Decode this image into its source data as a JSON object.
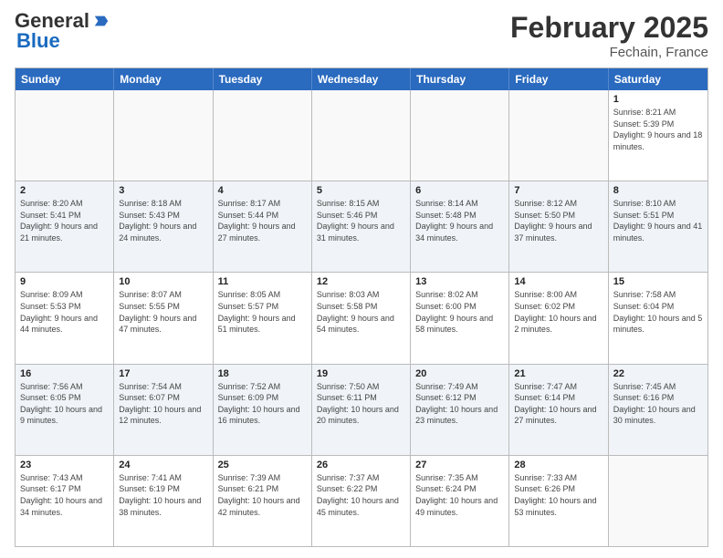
{
  "header": {
    "logo_general": "General",
    "logo_blue": "Blue",
    "month_title": "February 2025",
    "location": "Fechain, France"
  },
  "days_of_week": [
    "Sunday",
    "Monday",
    "Tuesday",
    "Wednesday",
    "Thursday",
    "Friday",
    "Saturday"
  ],
  "rows": [
    [
      {
        "day": "",
        "detail": "",
        "empty": true
      },
      {
        "day": "",
        "detail": "",
        "empty": true
      },
      {
        "day": "",
        "detail": "",
        "empty": true
      },
      {
        "day": "",
        "detail": "",
        "empty": true
      },
      {
        "day": "",
        "detail": "",
        "empty": true
      },
      {
        "day": "",
        "detail": "",
        "empty": true
      },
      {
        "day": "1",
        "detail": "Sunrise: 8:21 AM\nSunset: 5:39 PM\nDaylight: 9 hours and 18 minutes.",
        "empty": false
      }
    ],
    [
      {
        "day": "2",
        "detail": "Sunrise: 8:20 AM\nSunset: 5:41 PM\nDaylight: 9 hours and 21 minutes.",
        "empty": false
      },
      {
        "day": "3",
        "detail": "Sunrise: 8:18 AM\nSunset: 5:43 PM\nDaylight: 9 hours and 24 minutes.",
        "empty": false
      },
      {
        "day": "4",
        "detail": "Sunrise: 8:17 AM\nSunset: 5:44 PM\nDaylight: 9 hours and 27 minutes.",
        "empty": false
      },
      {
        "day": "5",
        "detail": "Sunrise: 8:15 AM\nSunset: 5:46 PM\nDaylight: 9 hours and 31 minutes.",
        "empty": false
      },
      {
        "day": "6",
        "detail": "Sunrise: 8:14 AM\nSunset: 5:48 PM\nDaylight: 9 hours and 34 minutes.",
        "empty": false
      },
      {
        "day": "7",
        "detail": "Sunrise: 8:12 AM\nSunset: 5:50 PM\nDaylight: 9 hours and 37 minutes.",
        "empty": false
      },
      {
        "day": "8",
        "detail": "Sunrise: 8:10 AM\nSunset: 5:51 PM\nDaylight: 9 hours and 41 minutes.",
        "empty": false
      }
    ],
    [
      {
        "day": "9",
        "detail": "Sunrise: 8:09 AM\nSunset: 5:53 PM\nDaylight: 9 hours and 44 minutes.",
        "empty": false
      },
      {
        "day": "10",
        "detail": "Sunrise: 8:07 AM\nSunset: 5:55 PM\nDaylight: 9 hours and 47 minutes.",
        "empty": false
      },
      {
        "day": "11",
        "detail": "Sunrise: 8:05 AM\nSunset: 5:57 PM\nDaylight: 9 hours and 51 minutes.",
        "empty": false
      },
      {
        "day": "12",
        "detail": "Sunrise: 8:03 AM\nSunset: 5:58 PM\nDaylight: 9 hours and 54 minutes.",
        "empty": false
      },
      {
        "day": "13",
        "detail": "Sunrise: 8:02 AM\nSunset: 6:00 PM\nDaylight: 9 hours and 58 minutes.",
        "empty": false
      },
      {
        "day": "14",
        "detail": "Sunrise: 8:00 AM\nSunset: 6:02 PM\nDaylight: 10 hours and 2 minutes.",
        "empty": false
      },
      {
        "day": "15",
        "detail": "Sunrise: 7:58 AM\nSunset: 6:04 PM\nDaylight: 10 hours and 5 minutes.",
        "empty": false
      }
    ],
    [
      {
        "day": "16",
        "detail": "Sunrise: 7:56 AM\nSunset: 6:05 PM\nDaylight: 10 hours and 9 minutes.",
        "empty": false
      },
      {
        "day": "17",
        "detail": "Sunrise: 7:54 AM\nSunset: 6:07 PM\nDaylight: 10 hours and 12 minutes.",
        "empty": false
      },
      {
        "day": "18",
        "detail": "Sunrise: 7:52 AM\nSunset: 6:09 PM\nDaylight: 10 hours and 16 minutes.",
        "empty": false
      },
      {
        "day": "19",
        "detail": "Sunrise: 7:50 AM\nSunset: 6:11 PM\nDaylight: 10 hours and 20 minutes.",
        "empty": false
      },
      {
        "day": "20",
        "detail": "Sunrise: 7:49 AM\nSunset: 6:12 PM\nDaylight: 10 hours and 23 minutes.",
        "empty": false
      },
      {
        "day": "21",
        "detail": "Sunrise: 7:47 AM\nSunset: 6:14 PM\nDaylight: 10 hours and 27 minutes.",
        "empty": false
      },
      {
        "day": "22",
        "detail": "Sunrise: 7:45 AM\nSunset: 6:16 PM\nDaylight: 10 hours and 30 minutes.",
        "empty": false
      }
    ],
    [
      {
        "day": "23",
        "detail": "Sunrise: 7:43 AM\nSunset: 6:17 PM\nDaylight: 10 hours and 34 minutes.",
        "empty": false
      },
      {
        "day": "24",
        "detail": "Sunrise: 7:41 AM\nSunset: 6:19 PM\nDaylight: 10 hours and 38 minutes.",
        "empty": false
      },
      {
        "day": "25",
        "detail": "Sunrise: 7:39 AM\nSunset: 6:21 PM\nDaylight: 10 hours and 42 minutes.",
        "empty": false
      },
      {
        "day": "26",
        "detail": "Sunrise: 7:37 AM\nSunset: 6:22 PM\nDaylight: 10 hours and 45 minutes.",
        "empty": false
      },
      {
        "day": "27",
        "detail": "Sunrise: 7:35 AM\nSunset: 6:24 PM\nDaylight: 10 hours and 49 minutes.",
        "empty": false
      },
      {
        "day": "28",
        "detail": "Sunrise: 7:33 AM\nSunset: 6:26 PM\nDaylight: 10 hours and 53 minutes.",
        "empty": false
      },
      {
        "day": "",
        "detail": "",
        "empty": true
      }
    ]
  ]
}
